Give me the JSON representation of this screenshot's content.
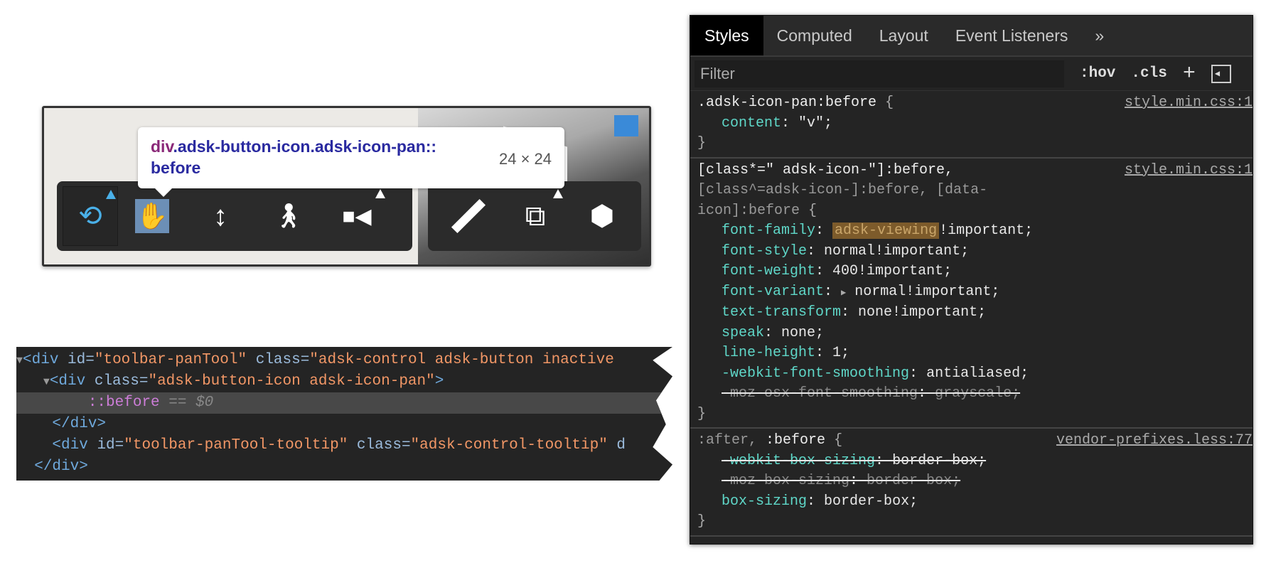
{
  "tooltip": {
    "tag": "div",
    "selector": ".adsk-button-icon.adsk-icon-pan::",
    "selector_line2": "before",
    "size": "24 × 24"
  },
  "toolbar": {
    "left": [
      {
        "icon": "orbit-icon",
        "glyph": "⟲",
        "active": true,
        "flyout": true
      },
      {
        "icon": "pan-hand-icon",
        "glyph": "✋",
        "highlighted": true,
        "flyout": false
      },
      {
        "icon": "zoom-dolly-icon",
        "glyph": "↕",
        "flyout": false
      },
      {
        "icon": "first-person-icon",
        "glyph": "🚶",
        "flyout": false
      },
      {
        "icon": "camera-icon",
        "glyph": "■◀",
        "flyout": true
      }
    ],
    "right": [
      {
        "icon": "measure-ruler-icon",
        "glyph": "📏",
        "flyout": false
      },
      {
        "icon": "section-box-icon",
        "glyph": "⧉",
        "flyout": true
      },
      {
        "icon": "explode-cube-icon",
        "glyph": "⬢",
        "flyout": false
      }
    ]
  },
  "dom": {
    "line1": {
      "tag": "<div",
      "attr1": " id=",
      "val1": "\"toolbar-panTool\"",
      "attr2": " class=",
      "val2": "\"adsk-control adsk-button inactive"
    },
    "line2": {
      "tag": "<div",
      "attr1": " class=",
      "val1": "\"adsk-button-icon adsk-icon-pan\"",
      "close": ">"
    },
    "line3": {
      "pseudo": "::before",
      "eq": " == ",
      "ref": "$0"
    },
    "line4": {
      "tag": "</div>"
    },
    "line5": {
      "tag": "<div",
      "attr1": " id=",
      "val1": "\"toolbar-panTool-tooltip\"",
      "attr2": " class=",
      "val2": "\"adsk-control-tooltip\"",
      "tail": " d"
    },
    "line6": {
      "tag": "</div>"
    }
  },
  "styles": {
    "tabs": [
      "Styles",
      "Computed",
      "Layout",
      "Event Listeners",
      "»"
    ],
    "filter_placeholder": "Filter",
    "hov": ":hov",
    "cls": ".cls",
    "plus": "+",
    "rules": [
      {
        "selector": ".adsk-icon-pan:before",
        "source": "style.min.css:1",
        "decls": [
          {
            "k": "content",
            "v": "\"v\";"
          }
        ]
      },
      {
        "selector": "[class*=\" adsk-icon-\"]:before,",
        "selector_dim": "[class^=adsk-icon-]:before, [data-icon]:before",
        "source": "style.min.css:1",
        "decls": [
          {
            "k": "font-family",
            "v_hl": "adsk-viewing",
            "v": "!important;"
          },
          {
            "k": "font-style",
            "v": "normal!important;"
          },
          {
            "k": "font-weight",
            "v": "400!important;"
          },
          {
            "k": "font-variant",
            "v": "normal!important;",
            "expand": true
          },
          {
            "k": "text-transform",
            "v": "none!important;"
          },
          {
            "k": "speak",
            "v": "none;"
          },
          {
            "k": "line-height",
            "v": "1;"
          },
          {
            "k": "-webkit-font-smoothing",
            "v": "antialiased;"
          },
          {
            "k": "-moz-osx-font-smoothing",
            "v": "grayscale;",
            "struck": true,
            "dim": true
          }
        ]
      },
      {
        "selector_dim": ":after,",
        "selector": ":before",
        "source": "vendor-prefixes.less:77",
        "decls": [
          {
            "k": "-webkit-box-sizing",
            "v": "border-box;",
            "struck": true
          },
          {
            "k": "-moz-box-sizing",
            "v": "border-box;",
            "struck": true,
            "dim": true
          },
          {
            "k": "box-sizing",
            "v": "border-box;"
          }
        ]
      }
    ]
  }
}
